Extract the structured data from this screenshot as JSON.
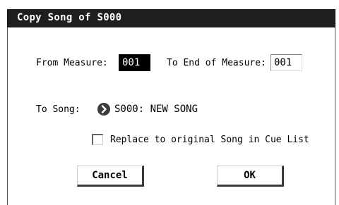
{
  "dialog": {
    "title": "Copy Song of S000",
    "from_measure_label": "From Measure:",
    "from_measure_value": "001",
    "to_end_label": "To End of Measure:",
    "to_end_value": "001",
    "to_song_label": "To Song:",
    "to_song_value": "S000: NEW SONG",
    "replace_checkbox_label": "Replace to original Song in Cue List",
    "replace_checked": false,
    "cancel_label": "Cancel",
    "ok_label": "OK"
  },
  "icons": {
    "song_select": "chevron-right-circle-icon"
  }
}
